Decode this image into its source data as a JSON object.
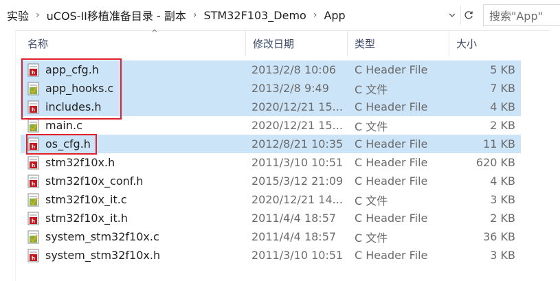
{
  "breadcrumb": {
    "items": [
      "实验",
      "uCOS-II移植准备目录 - 副本",
      "STM32F103_Demo",
      "App"
    ],
    "separator": "›"
  },
  "search": {
    "placeholder": "搜索\"App\""
  },
  "columns": {
    "name": "名称",
    "date": "修改日期",
    "type": "类型",
    "size": "大小"
  },
  "files": [
    {
      "name": "app_cfg.h",
      "date": "2013/2/8 10:06",
      "type": "C Header File",
      "size": "5 KB",
      "icon": "h-file-icon",
      "selected": true
    },
    {
      "name": "app_hooks.c",
      "date": "2013/2/8 9:49",
      "type": "C 文件",
      "size": "7 KB",
      "icon": "c-file-icon",
      "selected": true
    },
    {
      "name": "includes.h",
      "date": "2020/12/21 15...",
      "type": "C Header File",
      "size": "4 KB",
      "icon": "h-file-icon",
      "selected": true
    },
    {
      "name": "main.c",
      "date": "2020/12/21 15...",
      "type": "C 文件",
      "size": "2 KB",
      "icon": "c-file-icon",
      "selected": false
    },
    {
      "name": "os_cfg.h",
      "date": "2012/8/21 10:35",
      "type": "C Header File",
      "size": "11 KB",
      "icon": "h-file-icon",
      "selected": true
    },
    {
      "name": "stm32f10x.h",
      "date": "2011/3/10 10:51",
      "type": "C Header File",
      "size": "620 KB",
      "icon": "h-file-icon",
      "selected": false
    },
    {
      "name": "stm32f10x_conf.h",
      "date": "2015/3/12 21:09",
      "type": "C Header File",
      "size": "4 KB",
      "icon": "h-file-icon",
      "selected": false
    },
    {
      "name": "stm32f10x_it.c",
      "date": "2020/12/21 14...",
      "type": "C 文件",
      "size": "3 KB",
      "icon": "c-file-icon",
      "selected": false
    },
    {
      "name": "stm32f10x_it.h",
      "date": "2011/4/4 18:57",
      "type": "C Header File",
      "size": "2 KB",
      "icon": "h-file-icon",
      "selected": false
    },
    {
      "name": "system_stm32f10x.c",
      "date": "2011/4/4 18:57",
      "type": "C 文件",
      "size": "36 KB",
      "icon": "c-file-icon",
      "selected": false
    },
    {
      "name": "system_stm32f10x.h",
      "date": "2011/3/10 10:51",
      "type": "C Header File",
      "size": "3 KB",
      "icon": "h-file-icon",
      "selected": false
    }
  ],
  "colors": {
    "selection": "#cce4f7",
    "highlight_box": "#e0202a",
    "header_text": "#3b4a6b"
  }
}
